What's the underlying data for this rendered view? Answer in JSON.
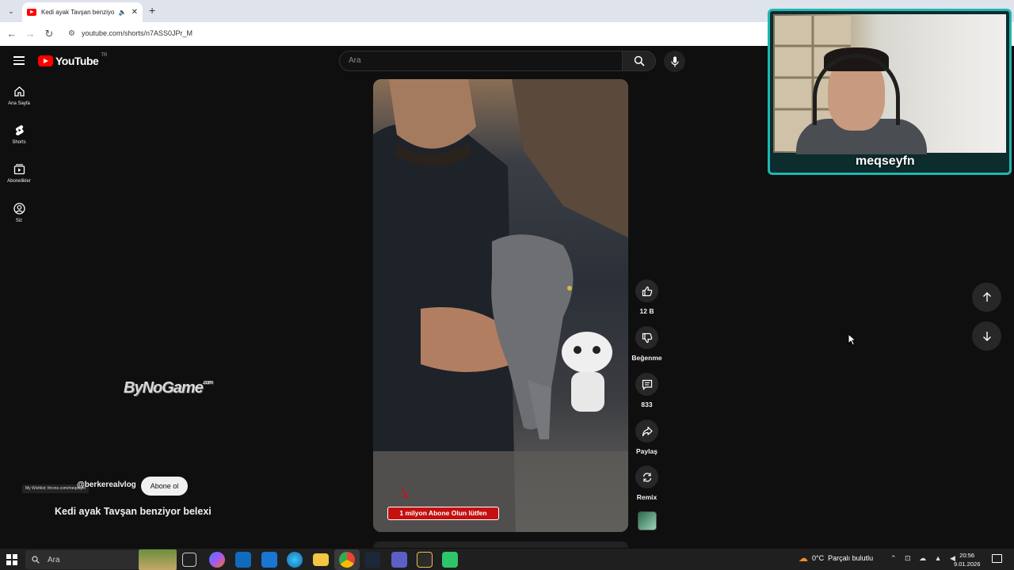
{
  "browser": {
    "tab_title": "Kedi ayak Tavşan benziyor b",
    "tab_close": "✕",
    "new_tab": "+",
    "url": "youtube.com/shorts/n7ASS0JPr_M"
  },
  "youtube": {
    "logo_text": "YouTube",
    "country_code": "TR",
    "search_placeholder": "Ara",
    "sidebar": [
      {
        "label": "Ana Sayfa",
        "icon": "home-icon"
      },
      {
        "label": "Shorts",
        "icon": "shorts-icon"
      },
      {
        "label": "Abonelikler",
        "icon": "subscriptions-icon"
      },
      {
        "label": "Siz",
        "icon": "account-icon"
      }
    ],
    "short": {
      "channel_handle": "@berkerealvlog",
      "subscribe_label": "Abone ol",
      "title": "Kedi ayak Tavşan benziyor belexi",
      "overlay_text": "1 milyon Abone Olun lütfen",
      "actions": {
        "likes": "12 B",
        "dislike": "Beğenme",
        "comments": "833",
        "share": "Paylaş",
        "remix": "Remix"
      }
    }
  },
  "watermark": {
    "brand": "ByNoGame",
    "suffix": ".com"
  },
  "wishlist_text": "My Wishlist: throne.com/meqseyfn",
  "webcam": {
    "streamer_name": "meqseyfn",
    "frame_color": "#1fb7b0"
  },
  "taskbar": {
    "search_placeholder": "Ara",
    "weather_temp": "0°C",
    "weather_desc": "Parçalı bulutlu",
    "time": "20:56",
    "date": "9.01.2026",
    "tray_icons": "⌃ ⊡ ☁ ▲ ◀"
  },
  "colors": {
    "yt_red": "#ff0000",
    "yt_bg": "#0f0f0f",
    "cta_red": "#c41010"
  }
}
